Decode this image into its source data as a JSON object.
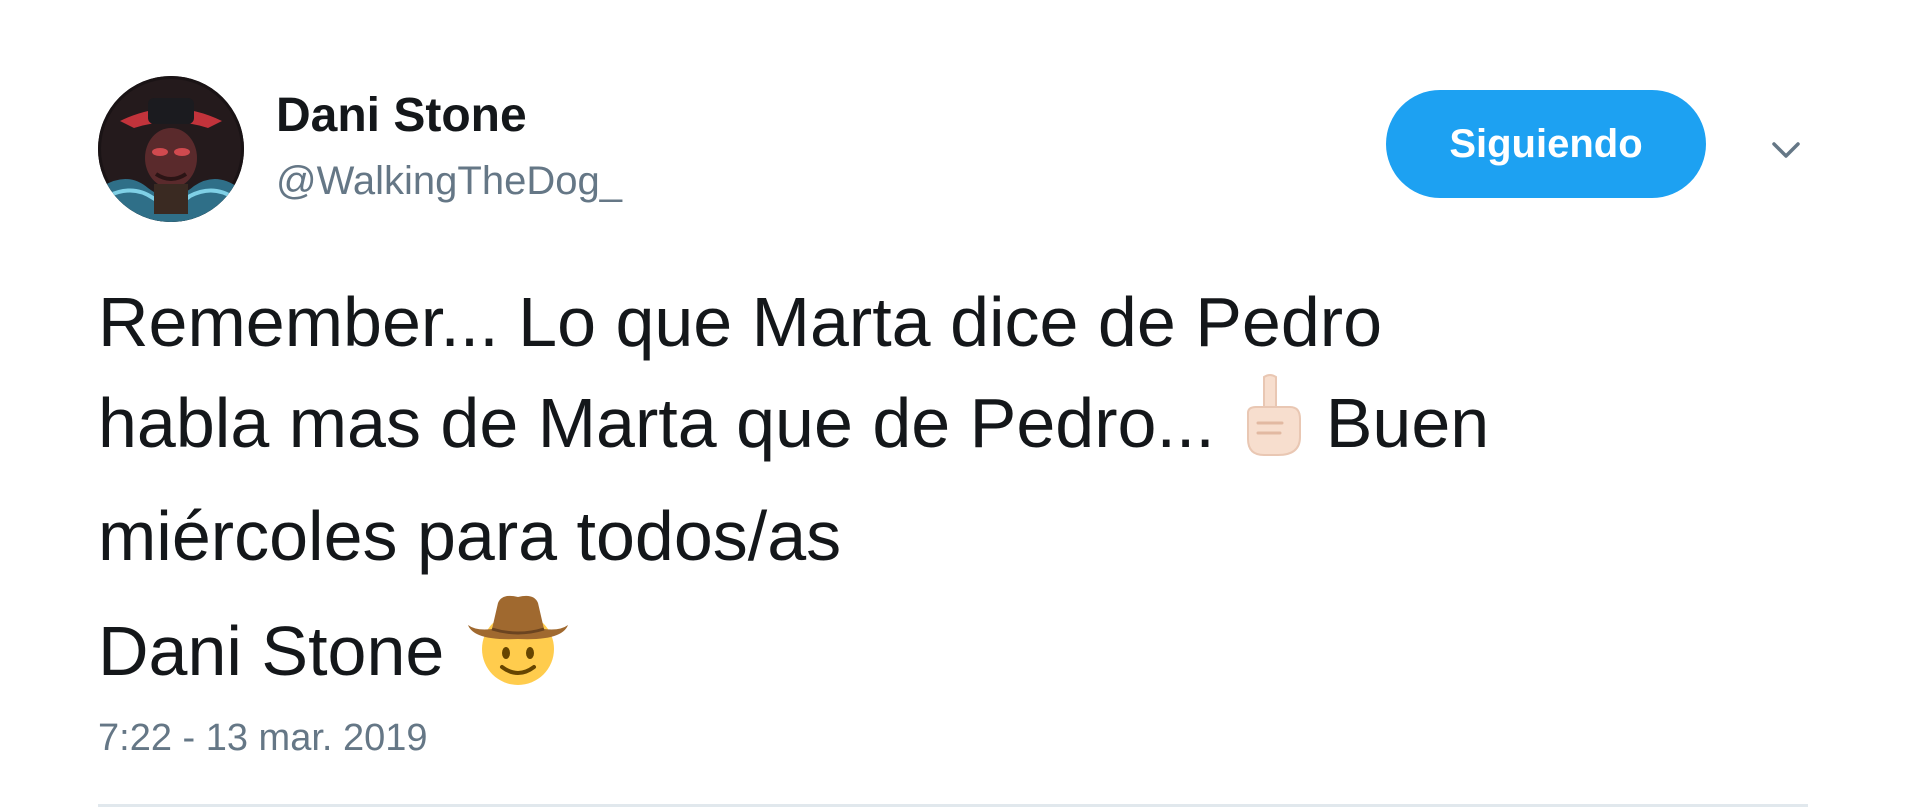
{
  "user": {
    "display_name": "Dani Stone",
    "handle": "@WalkingTheDog_",
    "avatar_icon": "avatar-image"
  },
  "follow_button": {
    "label": "Siguiendo",
    "color": "#1da1f2"
  },
  "menu": {
    "icon": "chevron-down-icon"
  },
  "tweet": {
    "line1": "Remember... Lo que Marta dice de Pedro",
    "line2_a": "habla mas de Marta que de Pedro... ",
    "line2_emoji": "pointing-up-emoji",
    "line2_b": " Buen",
    "line3": "miércoles para todos/as",
    "line4": "Dani Stone ",
    "line4_emoji": "cowboy-face-emoji"
  },
  "timestamp": "7:22 - 13 mar. 2019",
  "colors": {
    "text": "#14171a",
    "secondary": "#657786",
    "accent": "#1da1f2",
    "divider": "#e1e8ed"
  }
}
